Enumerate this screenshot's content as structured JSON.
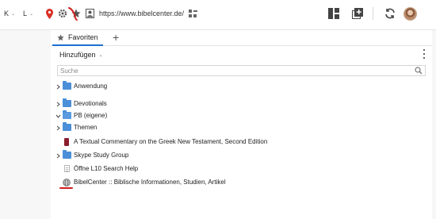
{
  "toolbar": {
    "lang1": "K",
    "lang2": "L",
    "url": "https://www.bibelcenter.de/"
  },
  "panel": {
    "tab_label": "Favoriten",
    "add_tab": "+",
    "hinzufuegen": "Hinzufügen",
    "search_placeholder": "Suche"
  },
  "items": [
    {
      "label": "Anwendung",
      "type": "folder",
      "expander": ">"
    },
    {
      "label": "Devotionals",
      "type": "folder",
      "expander": ">"
    },
    {
      "label": "PB (eigene)",
      "type": "folder-open",
      "expander": "v"
    },
    {
      "label": "Themen",
      "type": "folder",
      "expander": ">"
    },
    {
      "label": "A Textual Commentary on the Greek New Testament, Second Edition",
      "type": "book",
      "expander": ""
    },
    {
      "label": "Skype Study Group",
      "type": "folder",
      "expander": ">"
    },
    {
      "label": "Öffne L10 Search Help",
      "type": "doc",
      "expander": ""
    },
    {
      "label": "BibelCenter :: Biblische Informationen, Studien, Artikel",
      "type": "web",
      "expander": ""
    }
  ],
  "colors": {
    "accent": "#1e6fd0",
    "folder": "#4a8fd8",
    "annotation": "#d21f1f"
  }
}
